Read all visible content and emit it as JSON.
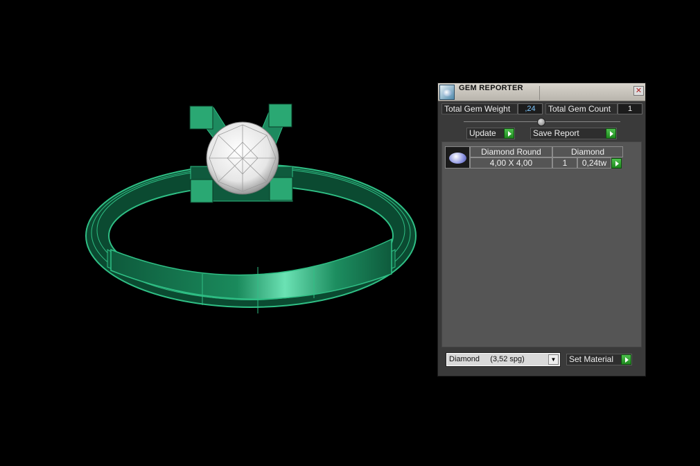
{
  "panel": {
    "title": "GEM REPORTER",
    "close_icon": "close-icon",
    "total_gem_weight_label": "Total Gem Weight",
    "total_gem_weight_value": ",24",
    "total_gem_count_label": "Total Gem Count",
    "total_gem_count_value": "1",
    "update_label": "Update",
    "save_report_label": "Save Report"
  },
  "gem_list": {
    "headers": [
      "Diamond Round",
      "Diamond"
    ],
    "rows": [
      {
        "size": "4,00 X 4,00",
        "count": "1",
        "weight": "0,24tw"
      }
    ]
  },
  "material": {
    "selected": "Diamond     (3,52 spg)",
    "set_material_label": "Set Material"
  },
  "colors": {
    "ring_green": "#1f9a6a",
    "accent_green": "#2fb02f",
    "weight_value_blue": "#7fc8ff"
  }
}
